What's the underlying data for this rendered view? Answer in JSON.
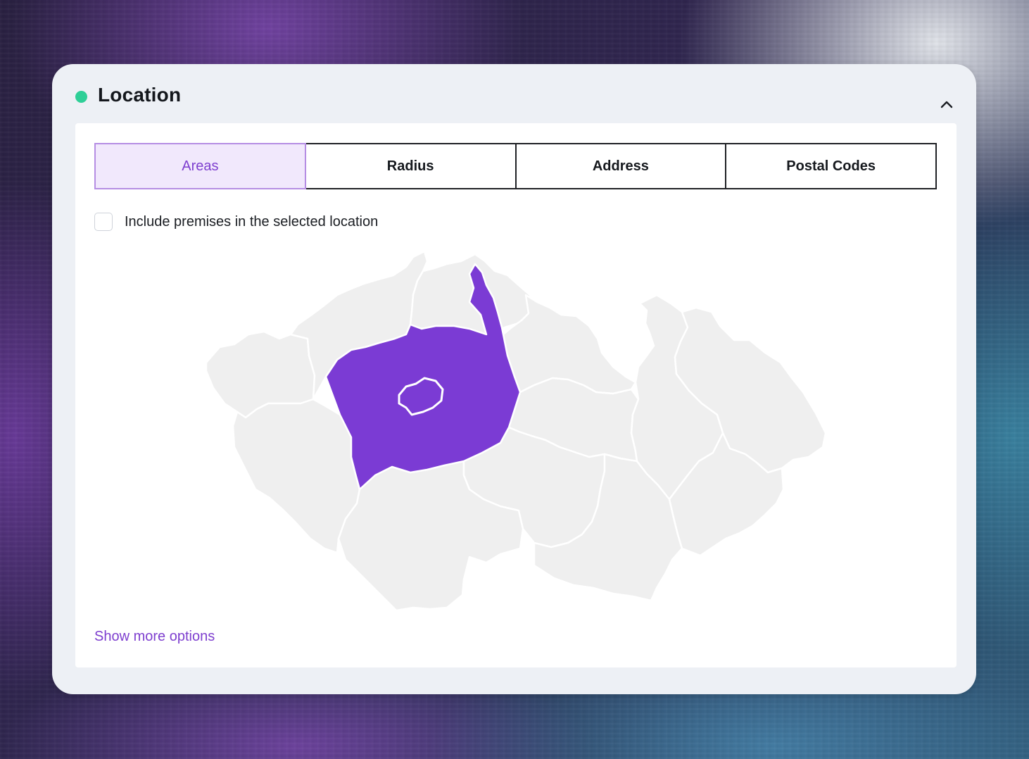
{
  "panel": {
    "title": "Location",
    "status_color": "#2ecf97",
    "collapse_icon": "chevron-up-icon"
  },
  "tabs": [
    {
      "label": "Areas",
      "active": true
    },
    {
      "label": "Radius",
      "active": false
    },
    {
      "label": "Address",
      "active": false
    },
    {
      "label": "Postal Codes",
      "active": false
    }
  ],
  "include_premises": {
    "label": "Include premises in the selected location",
    "checked": false
  },
  "map": {
    "country": "Czech Republic",
    "selected_region": "Central Bohemian Region",
    "selected_color": "#7b3bd4",
    "region_color": "#efefef"
  },
  "show_more": {
    "label": "Show more options"
  },
  "colors": {
    "accent": "#7e3fcf",
    "active_tab_bg": "#f1e8fc",
    "active_tab_border": "#b58de3"
  }
}
